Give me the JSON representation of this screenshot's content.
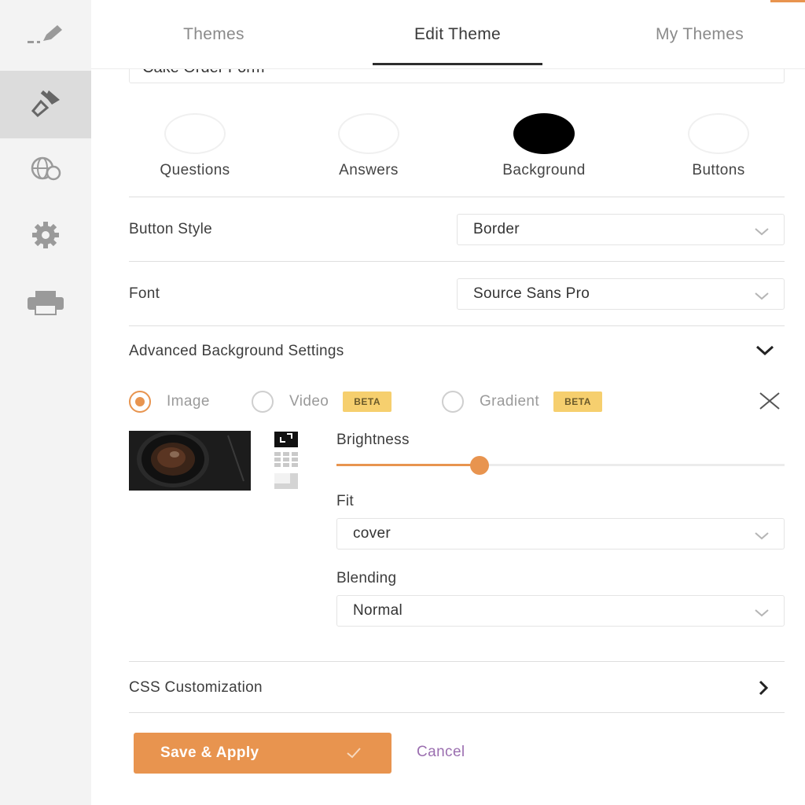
{
  "tabs": [
    {
      "label": "Themes",
      "active": false
    },
    {
      "label": "Edit Theme",
      "active": true
    },
    {
      "label": "My Themes",
      "active": false
    }
  ],
  "form_name": "Cake Order Form",
  "color_targets": [
    {
      "label": "Questions",
      "color": "#ffffff"
    },
    {
      "label": "Answers",
      "color": "#ffffff"
    },
    {
      "label": "Background",
      "color": "#000000"
    },
    {
      "label": "Buttons",
      "color": "#ffffff"
    }
  ],
  "button_style": {
    "label": "Button Style",
    "value": "Border"
  },
  "font": {
    "label": "Font",
    "value": "Source Sans Pro"
  },
  "advanced": {
    "title": "Advanced Background Settings",
    "options": [
      {
        "label": "Image",
        "selected": true
      },
      {
        "label": "Video",
        "badge": "BETA",
        "selected": false
      },
      {
        "label": "Gradient",
        "badge": "BETA",
        "selected": false
      }
    ],
    "brightness": {
      "label": "Brightness",
      "value": 0.32
    },
    "fit": {
      "label": "Fit",
      "value": "cover"
    },
    "blending": {
      "label": "Blending",
      "value": "Normal"
    }
  },
  "css_customization": {
    "label": "CSS Customization"
  },
  "actions": {
    "save": "Save & Apply",
    "cancel": "Cancel"
  },
  "colors": {
    "accent": "#e8944f",
    "beta": "#f6cf6e",
    "cancel": "#9b6fb0"
  },
  "sidebar_icons": [
    "pencil-icon",
    "paint-brush-icon",
    "globe-icon",
    "gear-icon",
    "print-icon"
  ]
}
